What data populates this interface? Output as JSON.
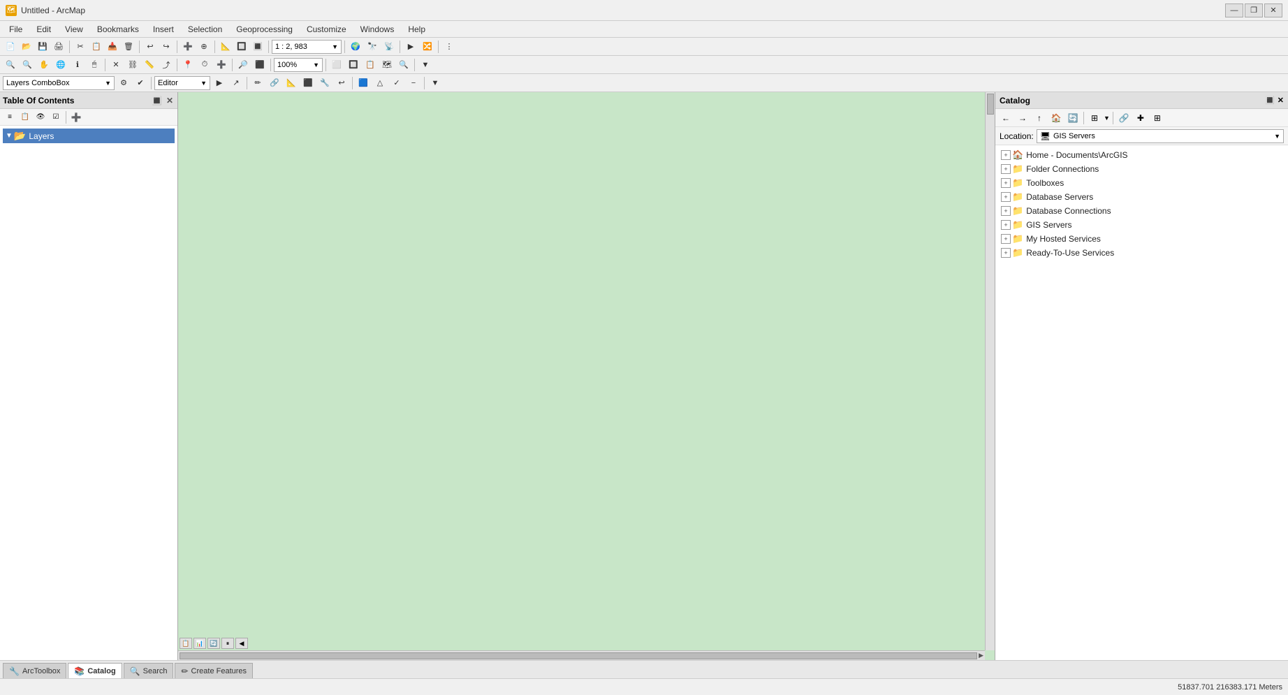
{
  "window": {
    "title": "Untitled - ArcMap",
    "icon": "🗺"
  },
  "titlebar": {
    "minimize": "—",
    "restore": "❐",
    "close": "✕"
  },
  "menu": {
    "items": [
      "File",
      "Edit",
      "View",
      "Bookmarks",
      "Insert",
      "Selection",
      "Geoprocessing",
      "Customize",
      "Windows",
      "Help"
    ]
  },
  "toolbar1": {
    "scale": "1 : 2, 983",
    "buttons": [
      "📄",
      "💾",
      "🖨",
      "✂",
      "📋",
      "🗑",
      "↩",
      "↪",
      "➕",
      "⊕",
      "📐",
      "🔲",
      "🔳",
      "⬜",
      "❏",
      "🔘",
      "⭕",
      "◈",
      "✚",
      "〒",
      "🔭",
      "📡",
      "▷",
      "🔀"
    ]
  },
  "toolbar2": {
    "buttons": [
      "🔍",
      "✋",
      "🌐",
      "✚",
      "✥",
      "🔲",
      "🖱",
      "ℹ",
      "✏",
      "📏",
      "⤴",
      "🔄",
      "📍",
      "🔍",
      "🔍",
      "📋",
      "⛓",
      "🔗",
      "🔎",
      "⬛"
    ]
  },
  "editorToolbar": {
    "layersComboLabel": "Layers ComboBox",
    "editorLabel": "Editor▼",
    "buttons": [
      "▶",
      "↗",
      "✏",
      "🔗",
      "📐",
      "⬛",
      "🔧",
      "↩",
      "🟦",
      "△",
      "✓",
      "−"
    ]
  },
  "toc": {
    "title": "Table Of Contents",
    "layers_label": "Layers",
    "toolbar_buttons": [
      "list-icon",
      "select-icon",
      "source-icon",
      "visibility-icon",
      "add-icon"
    ]
  },
  "catalog": {
    "title": "Catalog",
    "location_label": "Location:",
    "location_value": "GIS Servers",
    "tree_items": [
      {
        "label": "Home - Documents\\ArcGIS",
        "icon": "🏠",
        "type": "folder",
        "indent": 0
      },
      {
        "label": "Folder Connections",
        "icon": "📁",
        "type": "folder",
        "indent": 0
      },
      {
        "label": "Toolboxes",
        "icon": "📁",
        "type": "folder",
        "indent": 0
      },
      {
        "label": "Database Servers",
        "icon": "📁",
        "type": "folder",
        "indent": 0
      },
      {
        "label": "Database Connections",
        "icon": "📁",
        "type": "folder",
        "indent": 0
      },
      {
        "label": "GIS Servers",
        "icon": "📁",
        "type": "folder",
        "indent": 0
      },
      {
        "label": "My Hosted Services",
        "icon": "📁",
        "type": "folder",
        "indent": 0
      },
      {
        "label": "Ready-To-Use Services",
        "icon": "📁",
        "type": "folder",
        "indent": 0
      }
    ]
  },
  "bottomTabs": {
    "tabs": [
      {
        "label": "ArcToolbox",
        "icon": "🔧",
        "active": false
      },
      {
        "label": "Catalog",
        "icon": "📚",
        "active": true
      },
      {
        "label": "Search",
        "icon": "🔍",
        "active": false
      },
      {
        "label": "Create Features",
        "icon": "✏",
        "active": false
      }
    ]
  },
  "statusbar": {
    "coords": "51837.701  216383.171 Meters"
  },
  "colors": {
    "map_bg": "#c8e6c8",
    "selected_tab": "#4d7fbf",
    "selected_item": "#4d7fbf"
  }
}
